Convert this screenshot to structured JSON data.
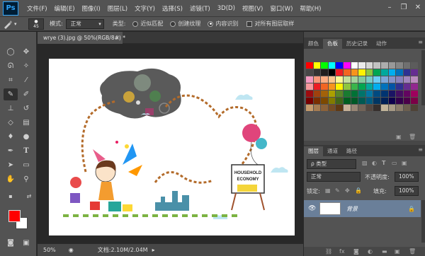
{
  "app": {
    "logo": "Ps"
  },
  "menu": [
    "文件(F)",
    "编辑(E)",
    "图像(I)",
    "图层(L)",
    "文字(Y)",
    "选择(S)",
    "滤镜(T)",
    "3D(D)",
    "视图(V)",
    "窗口(W)",
    "帮助(H)"
  ],
  "window_controls": {
    "minimize": "–",
    "restore": "❐",
    "close": "✕"
  },
  "options_bar": {
    "brush_size": "45",
    "mode_label": "模式:",
    "mode_value": "正常",
    "type_label": "类型:",
    "radio_1": "近似匹配",
    "radio_2": "创建纹理",
    "radio_3": "内容识别",
    "selected_radio": "内容识别",
    "sample_all_layers": "对所有图层取样"
  },
  "document": {
    "tab_title": "wrye (3).jpg @ 50%(RGB/8#) *",
    "tab_close": "×",
    "zoom": "50%",
    "doc_size": "文档:2.10M/2.04M"
  },
  "panels": {
    "top_tabs": [
      "颜色",
      "色板",
      "历史记录",
      "动作"
    ],
    "top_active": "色板",
    "layers_tabs": [
      "图层",
      "通道",
      "路径"
    ],
    "layers_active": "图层",
    "filter_label": "ρ 类型",
    "blend_mode": "正常",
    "opacity_label": "不透明度:",
    "opacity_value": "100%",
    "lock_label": "锁定:",
    "fill_label": "填充:",
    "fill_value": "100%",
    "layer_name": "背景"
  },
  "canvas_text": {
    "sign_line1": "HOUSEHOLD",
    "sign_line2": "ECONOMY"
  },
  "colors": {
    "foreground": "#ff0000",
    "background": "#ffffff",
    "ui_dark": "#282828",
    "ui_panel": "#535353",
    "layer_selected": "#6a7f99",
    "ps_blue": "#2fa3f7"
  },
  "swatches": [
    "#ff0000",
    "#ffff00",
    "#00ff00",
    "#00ffff",
    "#0000ff",
    "#ff00ff",
    "#ffffff",
    "#ebebeb",
    "#d6d6d6",
    "#c2c2c2",
    "#adadad",
    "#999999",
    "#858585",
    "#707070",
    "#5c5c5c",
    "#474747",
    "#333333",
    "#1f1f1f",
    "#000000",
    "#ee1d24",
    "#f26522",
    "#f7941d",
    "#fff200",
    "#8dc63f",
    "#00a651",
    "#00a99d",
    "#00aeef",
    "#0072bc",
    "#2e3192",
    "#662d91",
    "#f49ac1",
    "#f7977a",
    "#fbad82",
    "#fdc68c",
    "#fff799",
    "#c4df9b",
    "#a3d39c",
    "#82ca9c",
    "#7accc8",
    "#6dcff6",
    "#7da7d9",
    "#8493ca",
    "#8882be",
    "#a186be",
    "#bc8cbf",
    "#f6989d",
    "#ed1c24",
    "#f26522",
    "#f7941d",
    "#fff200",
    "#8dc63f",
    "#39b54a",
    "#00a651",
    "#00a99d",
    "#00aeef",
    "#0072bc",
    "#0054a6",
    "#2e3192",
    "#662d91",
    "#92278f",
    "#9e0b0f",
    "#a0410d",
    "#a36209",
    "#aba000",
    "#598527",
    "#197b30",
    "#007236",
    "#00746b",
    "#0076a3",
    "#004a80",
    "#003471",
    "#1b1464",
    "#440e62",
    "#630460",
    "#9e005d",
    "#790000",
    "#7b2e00",
    "#7d4900",
    "#827b00",
    "#406618",
    "#005e20",
    "#005826",
    "#005952",
    "#005b7f",
    "#003663",
    "#002157",
    "#0d004c",
    "#32004b",
    "#4b0049",
    "#7b0046",
    "#c69c6d",
    "#a67c52",
    "#8c6239",
    "#754c24",
    "#603913",
    "#c7b299",
    "#998675",
    "#736357",
    "#534741",
    "#362f2d",
    "#c2b59b",
    "#a69a85",
    "#8a7c6a",
    "#6d5f4f",
    "#4f4336"
  ]
}
